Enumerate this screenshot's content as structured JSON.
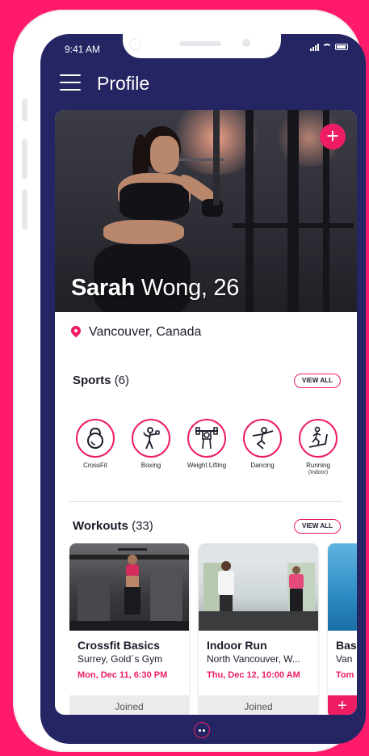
{
  "status_bar": {
    "time": "9:41 AM"
  },
  "header": {
    "title": "Profile"
  },
  "profile": {
    "first_name": "Sarah",
    "last_name_age": "Wong, 26",
    "location": "Vancouver, Canada"
  },
  "sports": {
    "heading": "Sports",
    "count": "(6)",
    "view_all": "VIEW ALL",
    "items": [
      {
        "label": "CrossFit",
        "sub": "",
        "icon": "kettlebell-icon"
      },
      {
        "label": "Boxing",
        "sub": "",
        "icon": "boxing-icon"
      },
      {
        "label": "Weight Lifting",
        "sub": "",
        "icon": "weightlifting-icon"
      },
      {
        "label": "Dancing",
        "sub": "",
        "icon": "dancing-icon"
      },
      {
        "label": "Running",
        "sub": "(Indoor)",
        "icon": "treadmill-icon"
      }
    ]
  },
  "workouts": {
    "heading": "Workouts",
    "count": "(33)",
    "view_all": "VIEW ALL",
    "items": [
      {
        "title": "Crossfit Basics",
        "location": "Surrey, Gold´s Gym",
        "date": "Mon, Dec 11, 6:30 PM",
        "status": "Joined"
      },
      {
        "title": "Indoor Run",
        "location": "North Vancouver, W...",
        "date": "Thu, Dec 12, 10:00 AM",
        "status": "Joined"
      },
      {
        "title": "Bas",
        "location": "Van",
        "date": "Tom",
        "status": "+"
      }
    ]
  },
  "colors": {
    "accent": "#ee1d63",
    "navy": "#262564",
    "background": "#ff1a6c"
  }
}
